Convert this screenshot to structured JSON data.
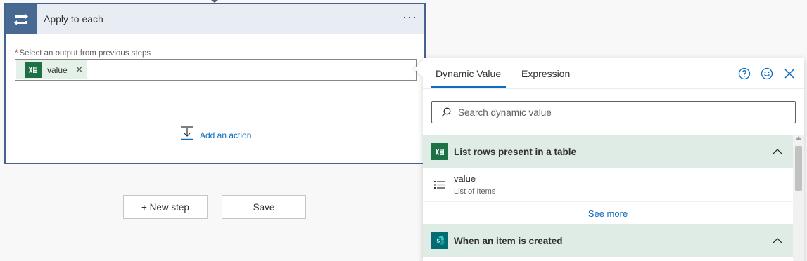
{
  "card": {
    "title": "Apply to each",
    "more_label": "···",
    "field_required_mark": "*",
    "field_label": "Select an output from previous steps",
    "token_label": "value",
    "add_action_label": "Add an action"
  },
  "buttons": {
    "new_step": "+ New step",
    "save": "Save"
  },
  "panel": {
    "tabs": [
      "Dynamic Value",
      "Expression"
    ],
    "active_tab": "Dynamic Value",
    "search_placeholder": "Search dynamic value",
    "groups": [
      {
        "title": "List rows present in a table",
        "icon": "excel-icon",
        "items": [
          {
            "name": "value",
            "description": "List of Items"
          }
        ],
        "see_more": "See more"
      },
      {
        "title": "When an item is created",
        "icon": "sharepoint-icon"
      }
    ]
  },
  "colors": {
    "accent": "#0f6cbd",
    "header_blue": "#486991",
    "group_bg": "#dfece6",
    "excel_green": "#1e7145",
    "sharepoint_teal": "#036c70"
  }
}
